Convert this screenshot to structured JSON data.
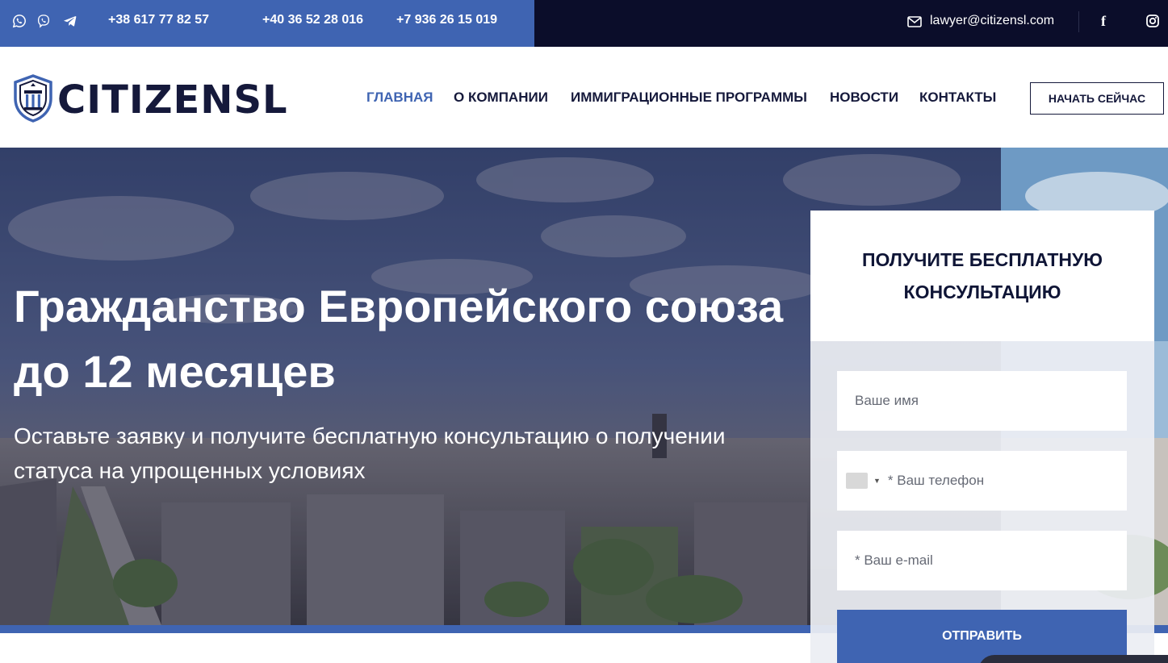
{
  "topbar": {
    "messengers": [
      "whatsapp-icon",
      "viber-icon",
      "telegram-icon"
    ],
    "phones": [
      "+38 617 77 82 57",
      "+40 36 52 28 016",
      "+7 936 26 15 019"
    ],
    "email": "lawyer@citizensl.com",
    "social": [
      "facebook-icon",
      "instagram-icon"
    ]
  },
  "header": {
    "logo_text": "CITIZENSL",
    "nav": [
      "ГЛАВНАЯ",
      "О КОМПАНИИ",
      "ИММИГРАЦИОННЫЕ ПРОГРАММЫ",
      "НОВОСТИ",
      "КОНТАКТЫ"
    ],
    "active_nav": "ГЛАВНАЯ",
    "cta_label": "НАЧАТЬ СЕЙЧАС"
  },
  "hero": {
    "title": "Гражданство Европейского союза до 12 месяцев",
    "subtitle": "Оставьте заявку и получите бесплатную консультацию о получении статуса на упрощенных условиях"
  },
  "form": {
    "title": "ПОЛУЧИТЕ БЕСПЛАТНУЮ КОНСУЛЬТАЦИЮ",
    "name_placeholder": "Ваше имя",
    "phone_placeholder": "* Ваш телефон",
    "email_placeholder": "* Ваш e-mail",
    "submit_label": "ОТПРАВИТЬ"
  },
  "colors": {
    "brand_blue": "#3f64b2",
    "navy": "#0b0d2a",
    "heading_dark": "#15193b"
  }
}
